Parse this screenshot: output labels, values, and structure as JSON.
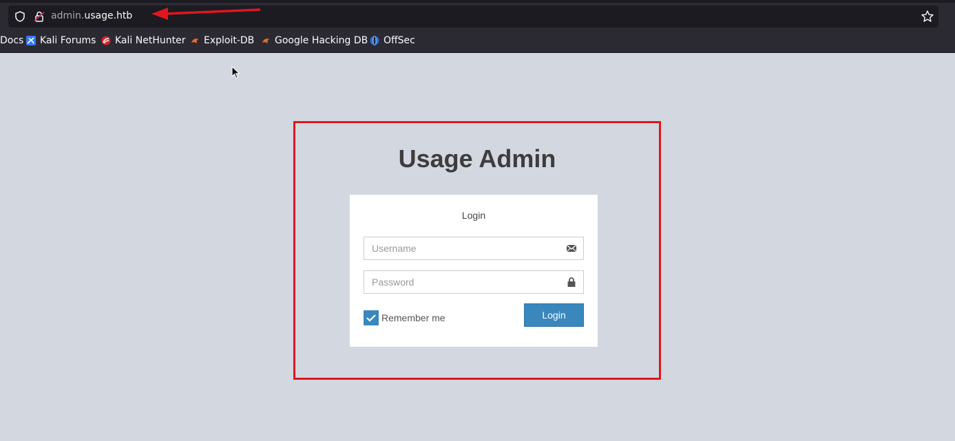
{
  "browser": {
    "url_prefix": "admin.",
    "url_domain": "usage.htb",
    "bookmarks": [
      {
        "label": "Docs",
        "icon": "none"
      },
      {
        "label": "Kali Forums",
        "icon": "kali-forums-icon"
      },
      {
        "label": "Kali NetHunter",
        "icon": "kali-nethunter-icon"
      },
      {
        "label": "Exploit-DB",
        "icon": "exploit-db-icon"
      },
      {
        "label": "Google Hacking DB",
        "icon": "exploit-db-icon"
      },
      {
        "label": "OffSec",
        "icon": "offsec-icon"
      }
    ]
  },
  "page": {
    "title": "Usage Admin",
    "panel_title": "Login",
    "username_placeholder": "Username",
    "password_placeholder": "Password",
    "remember_label": "Remember me",
    "remember_checked": true,
    "login_button": "Login"
  },
  "colors": {
    "page_bg": "#d3d7df",
    "accent": "#3a87be",
    "highlight": "#e0161e",
    "chrome_bg": "#2b2a33"
  }
}
